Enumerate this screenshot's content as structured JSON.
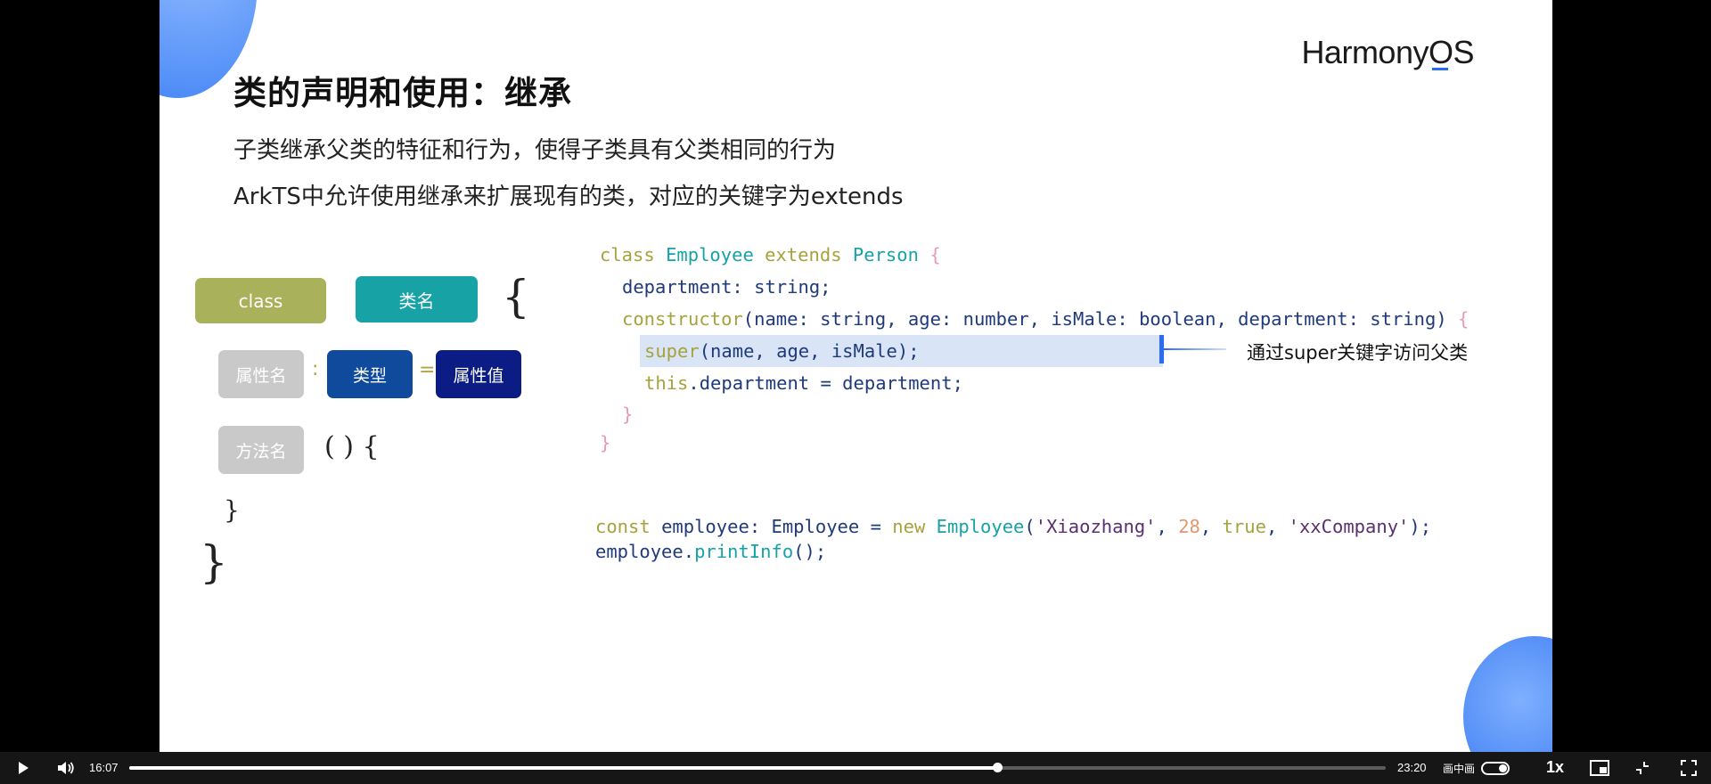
{
  "slide": {
    "logo": "HarmonyOS",
    "title": "类的声明和使用：继承",
    "subtitle1": "子类继承父类的特征和行为，使得子类具有父类相同的行为",
    "subtitle2": "ArkTS中允许使用继承来扩展现有的类，对应的关键字为extends",
    "diagram": {
      "class_label": "class",
      "classname_label": "类名",
      "prop_label": "属性名",
      "colon": ":",
      "type_label": "类型",
      "eq": "=",
      "value_label": "属性值",
      "method_label": "方法名",
      "paren": "( ) {",
      "brace_open": "{",
      "brace_inner_close": "}",
      "brace_close": "}"
    },
    "code": {
      "l1": {
        "kw1": "class",
        "cls1": "Employee",
        "kw2": "extends",
        "cls2": "Person",
        "br": "{"
      },
      "l2": {
        "name": "department",
        "rest": ": string;"
      },
      "l3": {
        "kw": "constructor",
        "body": "(name: string, age: number, isMale: boolean, department: string)",
        "br": "{"
      },
      "l4": {
        "kw": "super",
        "body": "(name, age, isMale);"
      },
      "l5": {
        "kw": "this",
        "body": ".department = department;"
      },
      "l6": {
        "br": "}"
      },
      "l7": {
        "br": "}"
      },
      "l8": {
        "kw1": "const",
        "var": "employee",
        "type": ": Employee = ",
        "kw2": "new",
        "cls": "Employee",
        "p1": "(",
        "s1": "'Xiaozhang'",
        "c1": ", ",
        "n1": "28",
        "c2": ", ",
        "kw3": "true",
        "c3": ", ",
        "s2": "'xxCompany'",
        "p2": ");"
      },
      "l9": {
        "var": "employee",
        "dot": ".",
        "fn": "printInfo",
        "rest": "();"
      }
    },
    "note": "通过super关键字访问父类"
  },
  "player": {
    "current_time": "16:07",
    "total_time": "23:20",
    "progress": 0.691,
    "pip_label": "画中画",
    "speed": "1x",
    "icons": [
      "play-icon",
      "volume-icon",
      "pip-toggle",
      "pip-window-icon",
      "exit-web-fullscreen-icon",
      "fullscreen-icon"
    ]
  }
}
